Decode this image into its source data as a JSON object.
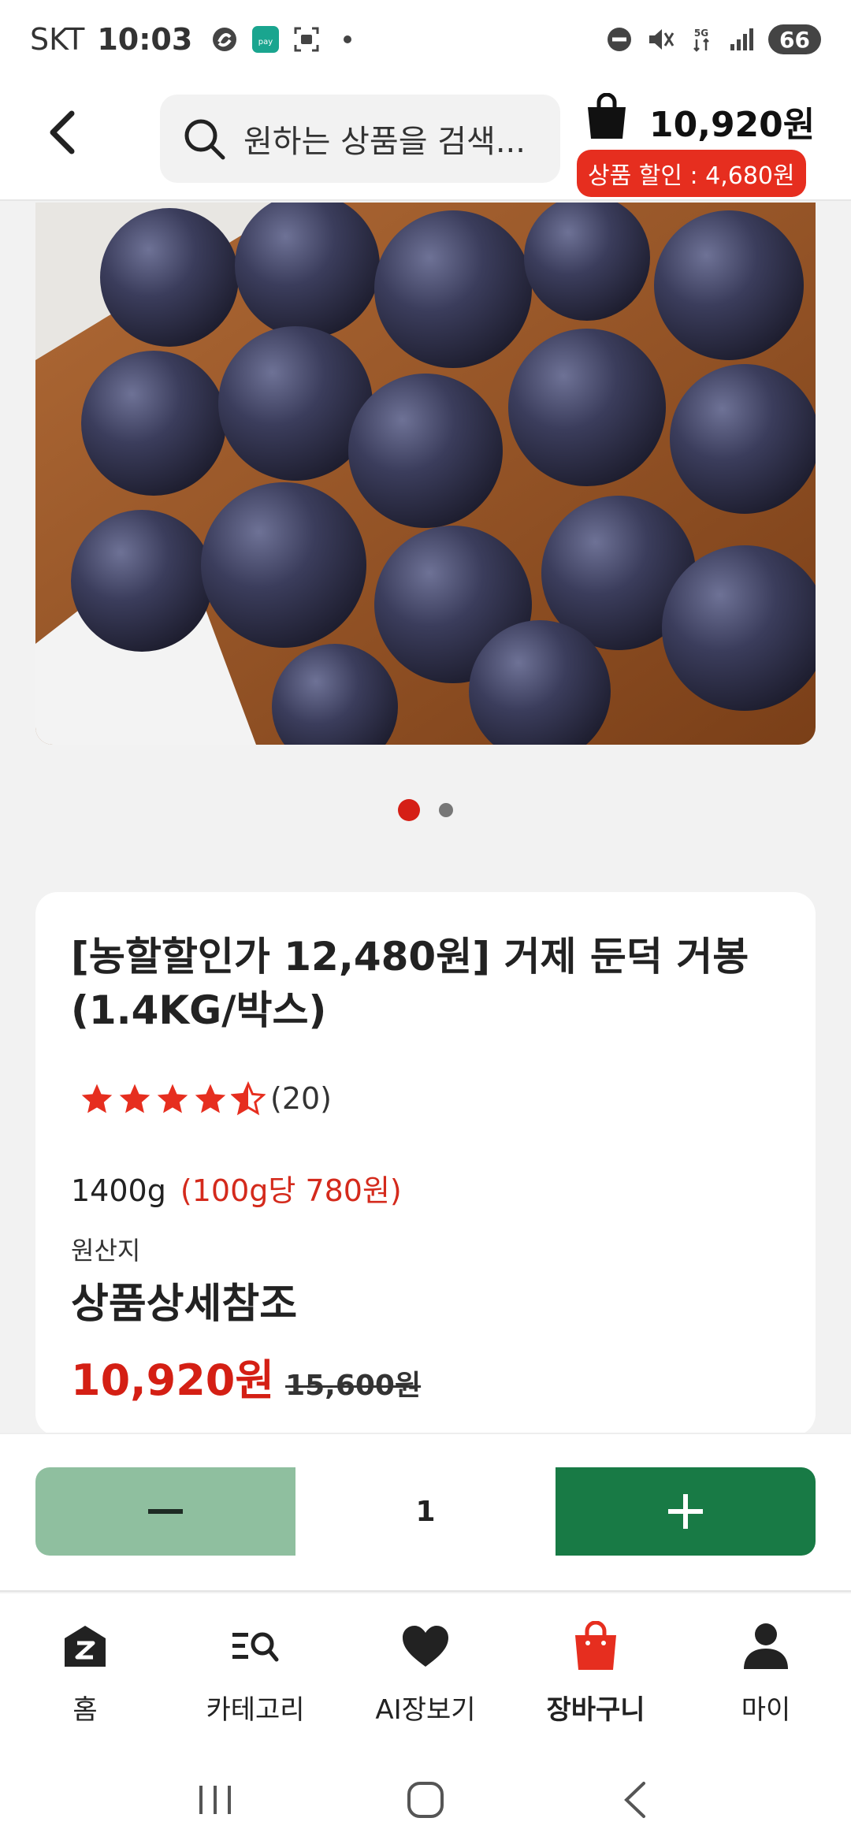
{
  "status_bar": {
    "carrier": "SKT",
    "time": "10:03",
    "battery": "66",
    "icons": [
      "samsung-pay-icon",
      "pay-app-icon",
      "screenshot-icon",
      "dot-icon",
      "dnd-icon",
      "mute-icon",
      "5g-icon",
      "signal-icon",
      "battery-icon"
    ]
  },
  "header": {
    "search_placeholder": "원하는 상품을 검색...",
    "cart_total": "10,920원",
    "cart_discount": "상품 할인 : 4,680원"
  },
  "carousel": {
    "slide_count": 2,
    "active_index": 0
  },
  "product": {
    "title": "[농할할인가 12,480원] 거제 둔덕 거봉 (1.4KG/박스)",
    "rating": 4.5,
    "review_count": "(20)",
    "weight": "1400g",
    "unit_price": "(100g당 780원)",
    "origin_label": "원산지",
    "origin_value": "상품상세참조",
    "sale_price": "10,920원",
    "original_price": "15,600원"
  },
  "quantity": {
    "value": "1"
  },
  "colors": {
    "accent_red": "#d41f14",
    "minus_green": "#8fbf9f",
    "plus_green": "#187a45"
  },
  "bottom_nav": {
    "items": [
      {
        "label": "홈",
        "icon": "home-icon"
      },
      {
        "label": "카테고리",
        "icon": "category-search-icon"
      },
      {
        "label": "AI장보기",
        "icon": "heart-icon"
      },
      {
        "label": "장바구니",
        "icon": "shopping-bag-icon",
        "active": true
      },
      {
        "label": "마이",
        "icon": "person-icon"
      }
    ]
  }
}
